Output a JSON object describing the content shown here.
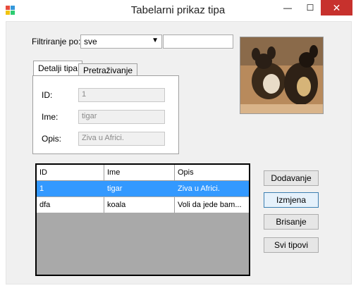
{
  "window": {
    "title": "Tabelarni prikaz tipa",
    "minimize_glyph": "—",
    "maximize_glyph": "☐",
    "close_glyph": "✕"
  },
  "filter": {
    "label": "Filtriranje po:",
    "combo_value": "sve",
    "search_value": ""
  },
  "tabs": [
    {
      "label": "Detalji tipa",
      "active": true
    },
    {
      "label": "Pretraživanje",
      "active": false
    }
  ],
  "details": {
    "id_label": "ID:",
    "id_value": "1",
    "ime_label": "Ime:",
    "ime_value": "tigar",
    "opis_label": "Opis:",
    "opis_value": "Ziva u Africi."
  },
  "grid": {
    "columns": [
      "ID",
      "Ime",
      "Opis"
    ],
    "rows": [
      {
        "id": "1",
        "ime": "tigar",
        "opis": "Ziva u Africi.",
        "selected": true
      },
      {
        "id": "dfa",
        "ime": "koala",
        "opis": "Voli da jede bam..."
      }
    ]
  },
  "buttons": {
    "add": "Dodavanje",
    "edit": "Izmjena",
    "delete": "Brisanje",
    "all": "Svi tipovi"
  },
  "colors": {
    "selection": "#3399ff",
    "close_button": "#c7312d",
    "grid_background": "#a9a9a9"
  }
}
